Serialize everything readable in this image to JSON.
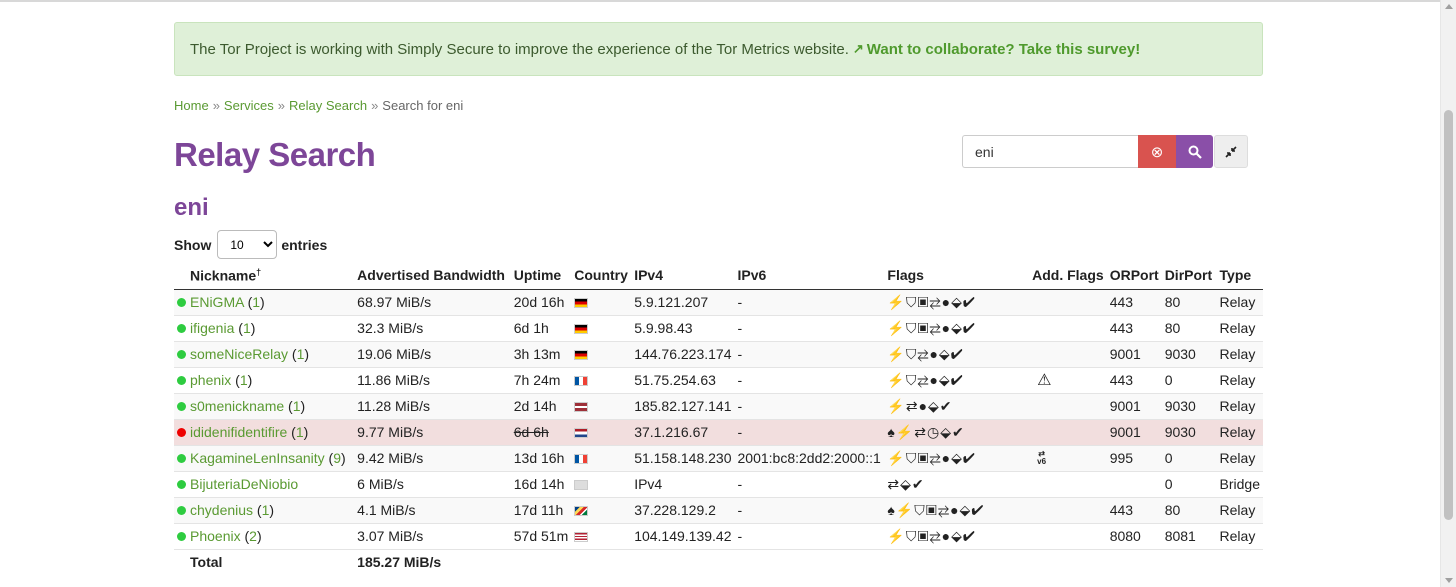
{
  "notice": {
    "text": "The Tor Project is working with Simply Secure to improve the experience of the Tor Metrics website.",
    "link_text": "Want to collaborate? Take this survey!"
  },
  "breadcrumb": {
    "home": "Home",
    "services": "Services",
    "relay_search": "Relay Search",
    "current": "Search for eni",
    "separator": "»"
  },
  "page_title": "Relay Search",
  "search": {
    "value": "eni"
  },
  "query_heading": "eni",
  "show_entries": {
    "show": "Show",
    "entries": "entries",
    "selected": "10"
  },
  "columns": [
    "Nickname",
    "Advertised Bandwidth",
    "Uptime",
    "Country",
    "IPv4",
    "IPv6",
    "Flags",
    "Add. Flags",
    "ORPort",
    "DirPort",
    "Type"
  ],
  "nickname_mark": "†",
  "rows": [
    {
      "status": "green",
      "nickname": "ENiGMA",
      "count": "1",
      "bandwidth": "68.97 MiB/s",
      "uptime": "20d 16h",
      "country": "de",
      "ipv4": "5.9.121.207",
      "ipv6": "-",
      "flags": "⚡⛉▣⇄●⬙✔",
      "add_flags": "",
      "orport": "443",
      "dirport": "80",
      "type": "Relay"
    },
    {
      "status": "green",
      "nickname": "ifigenia",
      "count": "1",
      "bandwidth": "32.3 MiB/s",
      "uptime": "6d 1h",
      "country": "de",
      "ipv4": "5.9.98.43",
      "ipv6": "-",
      "flags": "⚡⛉▣⇄●⬙✔",
      "add_flags": "",
      "orport": "443",
      "dirport": "80",
      "type": "Relay"
    },
    {
      "status": "green",
      "nickname": "someNiceRelay",
      "count": "1",
      "bandwidth": "19.06 MiB/s",
      "uptime": "3h 13m",
      "country": "de",
      "ipv4": "144.76.223.174",
      "ipv6": "-",
      "flags": "⚡⛉⇄●⬙✔",
      "add_flags": "",
      "orport": "9001",
      "dirport": "9030",
      "type": "Relay"
    },
    {
      "status": "green",
      "nickname": "phenix",
      "count": "1",
      "bandwidth": "11.86 MiB/s",
      "uptime": "7h 24m",
      "country": "fr",
      "ipv4": "51.75.254.63",
      "ipv6": "-",
      "flags": "⚡⛉⇄●⬙✔",
      "add_flags": "⚠",
      "orport": "443",
      "dirport": "0",
      "type": "Relay"
    },
    {
      "status": "green",
      "nickname": "s0menickname",
      "count": "1",
      "bandwidth": "11.28 MiB/s",
      "uptime": "2d 14h",
      "country": "lv",
      "ipv4": "185.82.127.141",
      "ipv6": "-",
      "flags": "⚡⇄●⬙✔",
      "add_flags": "",
      "orport": "9001",
      "dirport": "9030",
      "type": "Relay"
    },
    {
      "status": "red",
      "nickname": "ididenifidentifire",
      "count": "1",
      "bandwidth": "9.77 MiB/s",
      "uptime": "6d 6h",
      "country": "nl",
      "ipv4": "37.1.216.67",
      "ipv6": "-",
      "flags": "♠⚡⇄◷⬙✔",
      "add_flags": "",
      "orport": "9001",
      "dirport": "9030",
      "type": "Relay",
      "offline": true
    },
    {
      "status": "green",
      "nickname": "KagamineLenInsanity",
      "count": "9",
      "bandwidth": "9.42 MiB/s",
      "uptime": "13d 16h",
      "country": "fr",
      "ipv4": "51.158.148.230",
      "ipv6": "2001:bc8:2dd2:2000::1",
      "flags": "⚡⛉▣⇄●⬙✔",
      "add_flags": "v6",
      "orport": "995",
      "dirport": "0",
      "type": "Relay"
    },
    {
      "status": "green",
      "nickname": "BijuteriaDeNiobio",
      "count": "",
      "bandwidth": "6 MiB/s",
      "uptime": "16d 14h",
      "country": "unknown",
      "ipv4": "IPv4",
      "ipv6": "-",
      "flags": "⇄⬙✔",
      "add_flags": "",
      "orport": "",
      "dirport": "0",
      "type": "Bridge"
    },
    {
      "status": "green",
      "nickname": "chydenius",
      "count": "1",
      "bandwidth": "4.1 MiB/s",
      "uptime": "17d 11h",
      "country": "sc",
      "ipv4": "37.228.129.2",
      "ipv6": "-",
      "flags": "♠⚡⛉▣⇄●⬙✔",
      "add_flags": "",
      "orport": "443",
      "dirport": "80",
      "type": "Relay"
    },
    {
      "status": "green",
      "nickname": "Phoenix",
      "count": "2",
      "bandwidth": "3.07 MiB/s",
      "uptime": "57d 51m",
      "country": "us",
      "ipv4": "104.149.139.42",
      "ipv6": "-",
      "flags": "⚡⛉▣⇄●⬙✔",
      "add_flags": "",
      "orport": "8080",
      "dirport": "8081",
      "type": "Relay"
    }
  ],
  "total": {
    "label": "Total",
    "bandwidth": "185.27 MiB/s"
  }
}
